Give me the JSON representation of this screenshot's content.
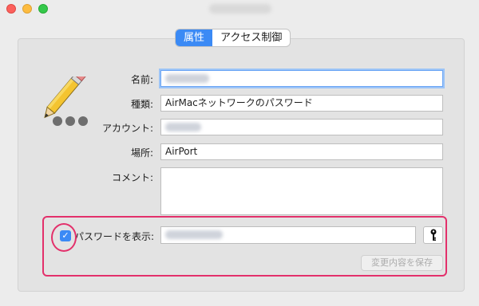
{
  "tabs": [
    {
      "label": "属性",
      "active": true
    },
    {
      "label": "アクセス制御",
      "active": false
    }
  ],
  "form": {
    "name_label": "名前:",
    "kind_label": "種類:",
    "kind_value": "AirMacネットワークのパスワード",
    "account_label": "アカウント:",
    "where_label": "場所:",
    "where_value": "AirPort",
    "comment_label": "コメント:",
    "show_password_label": "パスワードを表示:",
    "save_label": "変更内容を保存"
  },
  "icons": {
    "item_icon": "pencil-icon",
    "key": "key-icon",
    "checkbox": "checkmark-icon"
  },
  "colors": {
    "accent": "#3b8af5",
    "highlight": "#e3306b"
  }
}
